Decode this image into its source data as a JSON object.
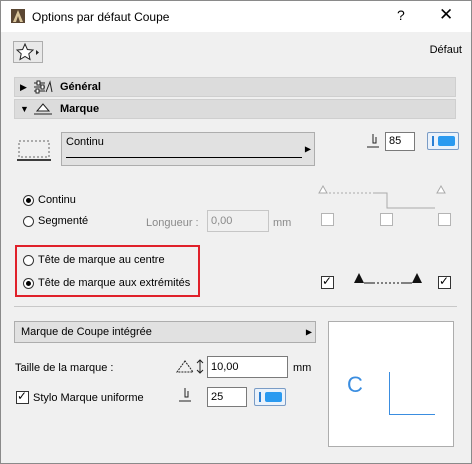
{
  "window": {
    "title": "Options par défaut Coupe",
    "help": "?",
    "close": "✕"
  },
  "toolbar": {
    "favorites_icon": "star-icon",
    "default_label": "Défaut"
  },
  "sections": [
    {
      "label": "Général",
      "expanded": false,
      "icon": "general-settings-icon"
    },
    {
      "label": "Marque",
      "expanded": true,
      "icon": "marker-icon"
    }
  ],
  "line": {
    "type": "Continu",
    "pen": "85"
  },
  "segment": {
    "options": [
      "Continu",
      "Segmenté"
    ],
    "selected": "Continu",
    "length_label": "Longueur :",
    "length_value": "0,00",
    "length_unit": "mm"
  },
  "marker_head": {
    "options": [
      "Tête de marque au centre",
      "Tête de marque aux extrémités"
    ],
    "selected": "Tête de marque aux extrémités"
  },
  "integrated": {
    "dropdown": "Marque de Coupe intégrée",
    "size_label": "Taille de la marque :",
    "size_value": "10,00",
    "size_unit": "mm",
    "uniform_pen_label": "Stylo Marque uniforme",
    "uniform_pen_checked": true,
    "pen": "25"
  },
  "preview": {
    "letter": "C"
  },
  "colors": {
    "accent": "#2a9af0",
    "highlight": "#e0202a",
    "preview_line": "#3a8de0"
  }
}
